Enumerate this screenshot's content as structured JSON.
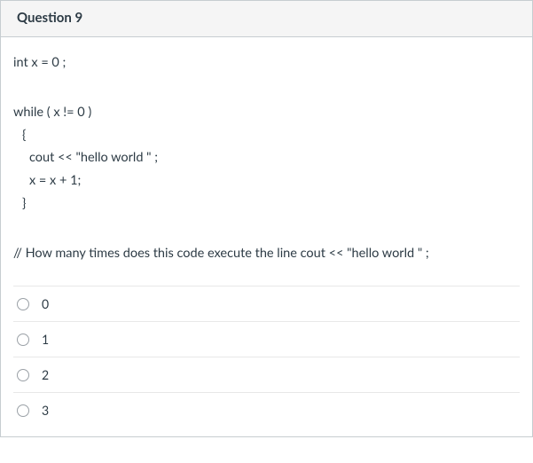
{
  "header": {
    "title": "Question 9"
  },
  "code": {
    "line1": "int x = 0 ;",
    "line2": "while ( x != 0 )",
    "line3": "{",
    "line4": "cout << \"hello world \" ;",
    "line5": "x = x + 1;",
    "line6": "}",
    "prompt": "// How many times does this code execute the line cout << \"hello world \" ;"
  },
  "choices": [
    {
      "label": "0"
    },
    {
      "label": "1"
    },
    {
      "label": "2"
    },
    {
      "label": "3"
    }
  ]
}
